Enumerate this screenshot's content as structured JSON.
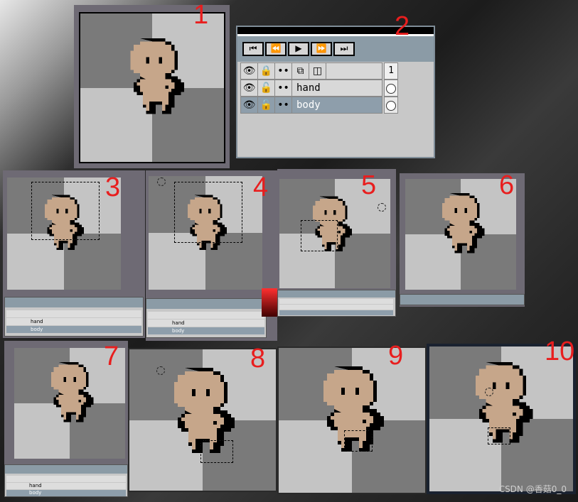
{
  "labels": [
    "1",
    "2",
    "3",
    "4",
    "5",
    "6",
    "7",
    "8",
    "9",
    "10"
  ],
  "timeline": {
    "controls": [
      "⏮",
      "⏪",
      "▶",
      "⏩",
      "⏭"
    ],
    "layers": [
      {
        "name": "",
        "frame": "1",
        "active": false,
        "header": true
      },
      {
        "name": "hand",
        "frame": "●",
        "active": false,
        "header": false
      },
      {
        "name": "body",
        "frame": "●",
        "active": true,
        "header": false
      }
    ],
    "icons": {
      "visibility": "eye-icon",
      "lock": "lock-icon",
      "continuous": "link-icon",
      "group": "group-icon",
      "copy": "frame-copy-icon"
    }
  },
  "watermark": "CSDN @香菇0_0",
  "colors": {
    "skin": "#c6a68a",
    "outline": "#000000",
    "label": "#e81e1e",
    "selected_layer": "#8e9eab"
  }
}
